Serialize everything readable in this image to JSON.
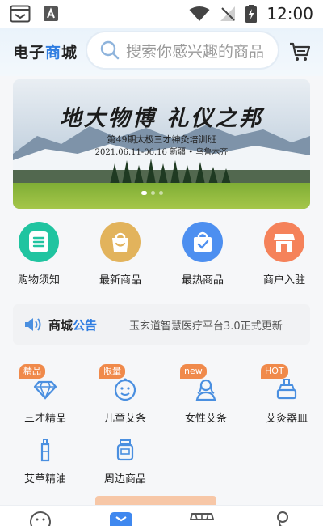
{
  "status_bar": {
    "time": "12:00"
  },
  "header": {
    "brand_prefix": "电子",
    "brand_accent": "商",
    "brand_suffix": "城",
    "search_placeholder": "搜索你感兴趣的商品"
  },
  "banner": {
    "title": "地大物博 礼仪之邦",
    "subtitle": "第49期太极三才神灸培训班",
    "date_line": "2021.06.11-06.16 新疆 • 乌鲁木齐"
  },
  "quick_entries": [
    {
      "label": "购物须知",
      "color": "#20c4a0",
      "icon": "list-icon"
    },
    {
      "label": "最新商品",
      "color": "#e2b35c",
      "icon": "shopping-bag-icon"
    },
    {
      "label": "最热商品",
      "color": "#4d8ff0",
      "icon": "hot-bag-icon"
    },
    {
      "label": "商户入驻",
      "color": "#f5825a",
      "icon": "shop-icon"
    }
  ],
  "notice": {
    "title_prefix": "商城",
    "title_accent": "公告",
    "text": "玉玄道智慧医疗平台3.0正式更新"
  },
  "categories": [
    {
      "label": "三才精品",
      "tag": "精品",
      "icon": "diamond-icon"
    },
    {
      "label": "儿童艾条",
      "tag": "限量",
      "icon": "child-face-icon"
    },
    {
      "label": "女性艾条",
      "tag": "new",
      "icon": "woman-icon"
    },
    {
      "label": "艾灸器皿",
      "tag": "HOT",
      "icon": "moxa-vessel-icon"
    },
    {
      "label": "艾草精油",
      "tag": "",
      "icon": "oil-bottle-icon"
    },
    {
      "label": "周边商品",
      "tag": "",
      "icon": "jar-icon"
    }
  ],
  "colors": {
    "accent": "#2f7de1",
    "tag": "#f08a4b",
    "icon_blue": "#4a8fe0"
  }
}
